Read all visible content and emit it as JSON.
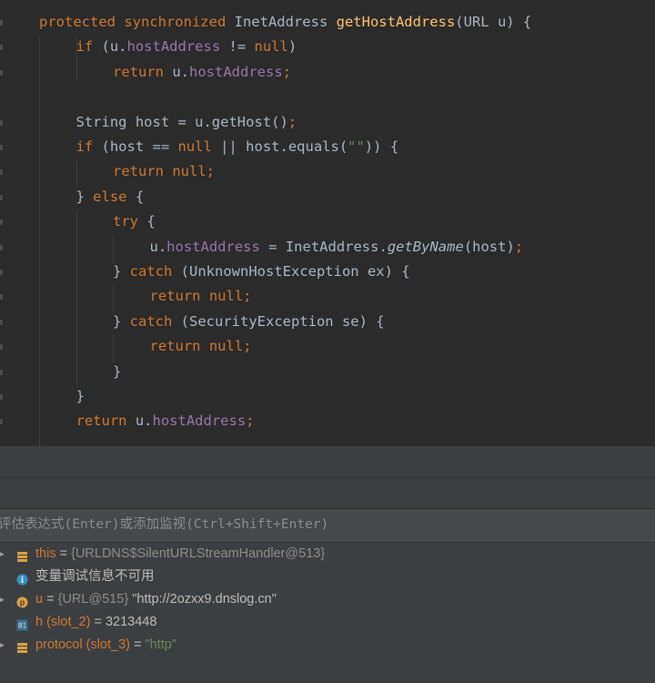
{
  "editor": {
    "lines": [
      {
        "indent": 0,
        "tokens": [
          [
            "kw",
            "protected synchronized "
          ],
          [
            "txt",
            "InetAddress "
          ],
          [
            "fn",
            "getHostAddress"
          ],
          [
            "txt",
            "(URL u) {"
          ]
        ]
      },
      {
        "indent": 1,
        "tokens": [
          [
            "kw",
            "if "
          ],
          [
            "txt",
            "(u."
          ],
          [
            "fld",
            "hostAddress"
          ],
          [
            "txt",
            " != "
          ],
          [
            "kw",
            "null"
          ],
          [
            "txt",
            ")"
          ]
        ]
      },
      {
        "indent": 2,
        "tokens": [
          [
            "kw",
            "return "
          ],
          [
            "txt",
            "u."
          ],
          [
            "fld",
            "hostAddress"
          ],
          [
            "kw",
            ";"
          ]
        ]
      },
      {
        "indent": 0,
        "tokens": []
      },
      {
        "indent": 1,
        "tokens": [
          [
            "txt",
            "String host = u.getHost()"
          ],
          [
            "kw",
            ";"
          ]
        ]
      },
      {
        "indent": 1,
        "tokens": [
          [
            "kw",
            "if "
          ],
          [
            "txt",
            "(host == "
          ],
          [
            "kw",
            "null "
          ],
          [
            "txt",
            "|| host.equals("
          ],
          [
            "str",
            "\"\""
          ],
          [
            "txt",
            ")) {"
          ]
        ]
      },
      {
        "indent": 2,
        "tokens": [
          [
            "kw",
            "return null;"
          ]
        ]
      },
      {
        "indent": 1,
        "tokens": [
          [
            "txt",
            "} "
          ],
          [
            "kw",
            "else "
          ],
          [
            "txt",
            "{"
          ]
        ]
      },
      {
        "indent": 2,
        "tokens": [
          [
            "kw",
            "try "
          ],
          [
            "txt",
            "{"
          ]
        ]
      },
      {
        "indent": 3,
        "tokens": [
          [
            "txt",
            "u."
          ],
          [
            "fld",
            "hostAddress"
          ],
          [
            "txt",
            " = InetAddress."
          ],
          [
            "it",
            "getByName"
          ],
          [
            "txt",
            "(host)"
          ],
          [
            "kw",
            ";"
          ]
        ]
      },
      {
        "indent": 2,
        "tokens": [
          [
            "txt",
            "} "
          ],
          [
            "kw",
            "catch "
          ],
          [
            "txt",
            "(UnknownHostException ex) {"
          ]
        ]
      },
      {
        "indent": 3,
        "tokens": [
          [
            "kw",
            "return null;"
          ]
        ]
      },
      {
        "indent": 2,
        "tokens": [
          [
            "txt",
            "} "
          ],
          [
            "kw",
            "catch "
          ],
          [
            "txt",
            "(SecurityException se) {"
          ]
        ]
      },
      {
        "indent": 3,
        "tokens": [
          [
            "kw",
            "return null;"
          ]
        ]
      },
      {
        "indent": 2,
        "tokens": [
          [
            "txt",
            "}"
          ]
        ]
      },
      {
        "indent": 1,
        "tokens": [
          [
            "txt",
            "}"
          ]
        ]
      },
      {
        "indent": 1,
        "tokens": [
          [
            "kw",
            "return "
          ],
          [
            "txt",
            "u."
          ],
          [
            "fld",
            "hostAddress"
          ],
          [
            "kw",
            ";"
          ]
        ]
      }
    ]
  },
  "debugger": {
    "eval_placeholder": "评估表达式(Enter)或添加监视(Ctrl+Shift+Enter)",
    "variables": [
      {
        "expandable": true,
        "icon": "field-list-icon",
        "name": "this",
        "eq": " = ",
        "type": "{URLDNS$SilentURLStreamHandler@513}",
        "value": ""
      },
      {
        "expandable": false,
        "icon": "info-icon",
        "name": "",
        "eq": "",
        "type": "",
        "value": "变量调试信息不可用",
        "plain": true
      },
      {
        "expandable": true,
        "icon": "parameter-icon",
        "name": "u",
        "eq": " = ",
        "type": "{URL@515} ",
        "value": "\"http://2ozxx9.dnslog.cn\""
      },
      {
        "expandable": false,
        "icon": "primitive-icon",
        "name": "h (slot_2)",
        "eq": " = ",
        "type": "",
        "value": "3213448",
        "plain": true
      },
      {
        "expandable": true,
        "icon": "field-list-icon",
        "name": "protocol (slot_3)",
        "eq": " = ",
        "type": "",
        "value": "\"http\"",
        "strval": true
      }
    ],
    "colors": {
      "keyword": "#cc7832",
      "function": "#ffc66d",
      "field": "#9876aa",
      "string": "#6a8759"
    }
  }
}
